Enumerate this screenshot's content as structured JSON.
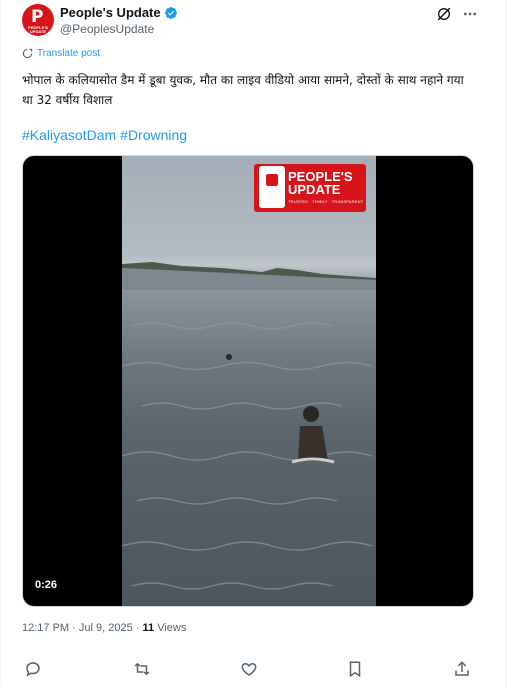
{
  "author": {
    "display_name": "People's Update",
    "handle": "@PeoplesUpdate",
    "avatar_initial": "P",
    "avatar_caption": "PEOPLE'S UPDATE"
  },
  "translate_label": "Translate post",
  "post": {
    "text": "भोपाल के कलियासोत डैम में डूबा युवक, मौत का लाइव वीडियो आया सामने, दोस्तों के साथ नहाने गया था 32 वर्षीय विशाल",
    "hashtags": [
      "#KaliyasotDam",
      "#Drowning"
    ]
  },
  "media": {
    "logo_line1": "PEOPLE'S",
    "logo_line2": "UPDATE",
    "logo_tagline": "TRUSTED · TIMELY · TRANSPARENT",
    "duration": "0:26"
  },
  "meta": {
    "time": "12:17 PM",
    "separator": " · ",
    "date": "Jul 9, 2025",
    "views_count": "11",
    "views_label": "Views"
  },
  "colors": {
    "accent": "#1d9bf0",
    "brand_red": "#d7141a",
    "muted": "#536471"
  },
  "icons": [
    "verified-badge-icon",
    "grok-icon",
    "more-icon",
    "translate-icon",
    "reply-icon",
    "repost-icon",
    "like-icon",
    "bookmark-icon",
    "share-icon"
  ]
}
